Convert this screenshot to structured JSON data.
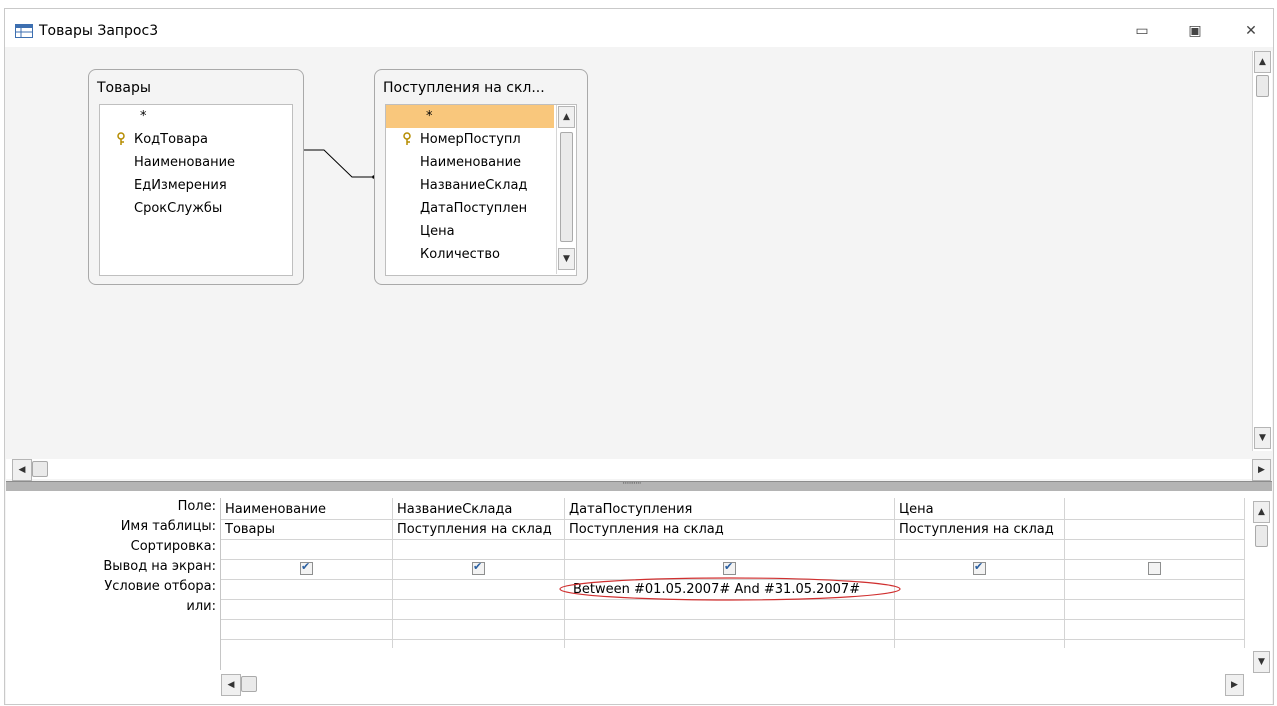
{
  "window": {
    "title": "Товары Запрос3",
    "minimize": "▭",
    "maximize": "▣",
    "close": "✕"
  },
  "tables": [
    {
      "title": "Товары",
      "fields": [
        "*",
        "КодТовара",
        "Наименование",
        "ЕдИзмерения",
        "СрокСлужбы"
      ],
      "key_field_index": 1
    },
    {
      "title": "Поступления на скл...",
      "fields": [
        "*",
        "НомерПоступл",
        "Наименование",
        "НазваниеСклад",
        "ДатаПоступлен",
        "Цена",
        "Количество"
      ],
      "key_field_index": 1,
      "selected_field_index": 0
    }
  ],
  "grid": {
    "row_labels": [
      "Поле:",
      "Имя таблицы:",
      "Сортировка:",
      "Вывод на экран:",
      "Условие отбора:",
      "или:"
    ],
    "columns": [
      {
        "field": "Наименование",
        "table": "Товары",
        "sort": "",
        "show": true,
        "criteria": "",
        "or": ""
      },
      {
        "field": "НазваниеСклада",
        "table": "Поступления на склад",
        "sort": "",
        "show": true,
        "criteria": "",
        "or": ""
      },
      {
        "field": "ДатаПоступления",
        "table": "Поступления на склад",
        "sort": "",
        "show": true,
        "criteria": "Between #01.05.2007# And #31.05.2007#",
        "or": ""
      },
      {
        "field": "Цена",
        "table": "Поступления на склад",
        "sort": "",
        "show": true,
        "criteria": "",
        "or": ""
      },
      {
        "field": "",
        "table": "",
        "sort": "",
        "show": false,
        "criteria": "",
        "or": ""
      }
    ]
  },
  "colors": {
    "selected_field": "#f9c77c",
    "highlight_ellipse": "#d03030",
    "splitter": "#b4b4b4"
  }
}
